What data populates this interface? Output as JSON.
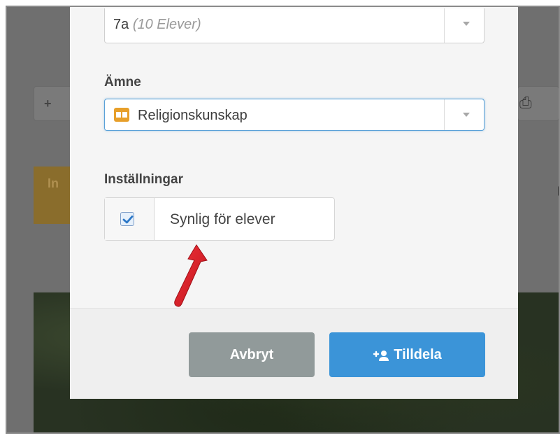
{
  "modal": {
    "class_select": {
      "value": "7a",
      "detail": "(10 Elever)",
      "icon": "chevron-down-icon"
    },
    "subject_label": "Ämne",
    "subject_select": {
      "value": "Religionskunskap",
      "icon": "book-icon"
    },
    "settings_label": "Inställningar",
    "visible_checkbox": {
      "label": "Synlig för elever",
      "checked": true
    },
    "cancel_label": "Avbryt",
    "assign_label": "Tilldela"
  },
  "background": {
    "tab_label": "In"
  },
  "colors": {
    "primary": "#3b94d8",
    "cancel": "#919a9a",
    "book_icon": "#e79f2a",
    "arrow": "#e0252e"
  }
}
